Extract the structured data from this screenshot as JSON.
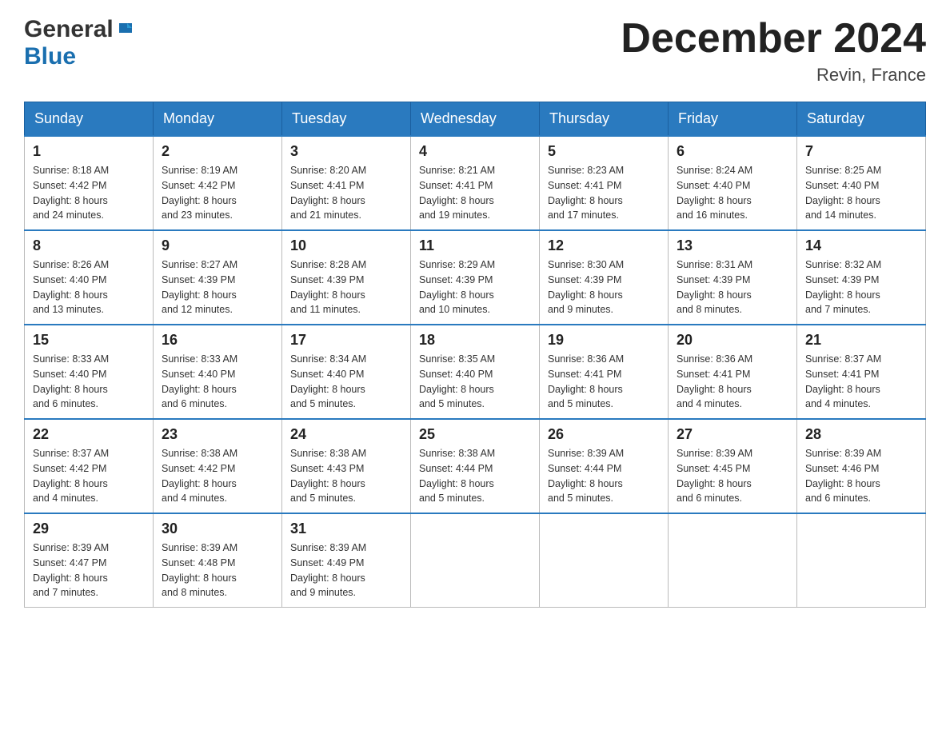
{
  "header": {
    "logo_general": "General",
    "logo_blue": "Blue",
    "month_title": "December 2024",
    "location": "Revin, France"
  },
  "weekdays": [
    "Sunday",
    "Monday",
    "Tuesday",
    "Wednesday",
    "Thursday",
    "Friday",
    "Saturday"
  ],
  "weeks": [
    [
      {
        "day": "1",
        "sunrise": "8:18 AM",
        "sunset": "4:42 PM",
        "daylight": "8 hours and 24 minutes."
      },
      {
        "day": "2",
        "sunrise": "8:19 AM",
        "sunset": "4:42 PM",
        "daylight": "8 hours and 23 minutes."
      },
      {
        "day": "3",
        "sunrise": "8:20 AM",
        "sunset": "4:41 PM",
        "daylight": "8 hours and 21 minutes."
      },
      {
        "day": "4",
        "sunrise": "8:21 AM",
        "sunset": "4:41 PM",
        "daylight": "8 hours and 19 minutes."
      },
      {
        "day": "5",
        "sunrise": "8:23 AM",
        "sunset": "4:41 PM",
        "daylight": "8 hours and 17 minutes."
      },
      {
        "day": "6",
        "sunrise": "8:24 AM",
        "sunset": "4:40 PM",
        "daylight": "8 hours and 16 minutes."
      },
      {
        "day": "7",
        "sunrise": "8:25 AM",
        "sunset": "4:40 PM",
        "daylight": "8 hours and 14 minutes."
      }
    ],
    [
      {
        "day": "8",
        "sunrise": "8:26 AM",
        "sunset": "4:40 PM",
        "daylight": "8 hours and 13 minutes."
      },
      {
        "day": "9",
        "sunrise": "8:27 AM",
        "sunset": "4:39 PM",
        "daylight": "8 hours and 12 minutes."
      },
      {
        "day": "10",
        "sunrise": "8:28 AM",
        "sunset": "4:39 PM",
        "daylight": "8 hours and 11 minutes."
      },
      {
        "day": "11",
        "sunrise": "8:29 AM",
        "sunset": "4:39 PM",
        "daylight": "8 hours and 10 minutes."
      },
      {
        "day": "12",
        "sunrise": "8:30 AM",
        "sunset": "4:39 PM",
        "daylight": "8 hours and 9 minutes."
      },
      {
        "day": "13",
        "sunrise": "8:31 AM",
        "sunset": "4:39 PM",
        "daylight": "8 hours and 8 minutes."
      },
      {
        "day": "14",
        "sunrise": "8:32 AM",
        "sunset": "4:39 PM",
        "daylight": "8 hours and 7 minutes."
      }
    ],
    [
      {
        "day": "15",
        "sunrise": "8:33 AM",
        "sunset": "4:40 PM",
        "daylight": "8 hours and 6 minutes."
      },
      {
        "day": "16",
        "sunrise": "8:33 AM",
        "sunset": "4:40 PM",
        "daylight": "8 hours and 6 minutes."
      },
      {
        "day": "17",
        "sunrise": "8:34 AM",
        "sunset": "4:40 PM",
        "daylight": "8 hours and 5 minutes."
      },
      {
        "day": "18",
        "sunrise": "8:35 AM",
        "sunset": "4:40 PM",
        "daylight": "8 hours and 5 minutes."
      },
      {
        "day": "19",
        "sunrise": "8:36 AM",
        "sunset": "4:41 PM",
        "daylight": "8 hours and 5 minutes."
      },
      {
        "day": "20",
        "sunrise": "8:36 AM",
        "sunset": "4:41 PM",
        "daylight": "8 hours and 4 minutes."
      },
      {
        "day": "21",
        "sunrise": "8:37 AM",
        "sunset": "4:41 PM",
        "daylight": "8 hours and 4 minutes."
      }
    ],
    [
      {
        "day": "22",
        "sunrise": "8:37 AM",
        "sunset": "4:42 PM",
        "daylight": "8 hours and 4 minutes."
      },
      {
        "day": "23",
        "sunrise": "8:38 AM",
        "sunset": "4:42 PM",
        "daylight": "8 hours and 4 minutes."
      },
      {
        "day": "24",
        "sunrise": "8:38 AM",
        "sunset": "4:43 PM",
        "daylight": "8 hours and 5 minutes."
      },
      {
        "day": "25",
        "sunrise": "8:38 AM",
        "sunset": "4:44 PM",
        "daylight": "8 hours and 5 minutes."
      },
      {
        "day": "26",
        "sunrise": "8:39 AM",
        "sunset": "4:44 PM",
        "daylight": "8 hours and 5 minutes."
      },
      {
        "day": "27",
        "sunrise": "8:39 AM",
        "sunset": "4:45 PM",
        "daylight": "8 hours and 6 minutes."
      },
      {
        "day": "28",
        "sunrise": "8:39 AM",
        "sunset": "4:46 PM",
        "daylight": "8 hours and 6 minutes."
      }
    ],
    [
      {
        "day": "29",
        "sunrise": "8:39 AM",
        "sunset": "4:47 PM",
        "daylight": "8 hours and 7 minutes."
      },
      {
        "day": "30",
        "sunrise": "8:39 AM",
        "sunset": "4:48 PM",
        "daylight": "8 hours and 8 minutes."
      },
      {
        "day": "31",
        "sunrise": "8:39 AM",
        "sunset": "4:49 PM",
        "daylight": "8 hours and 9 minutes."
      },
      null,
      null,
      null,
      null
    ]
  ],
  "labels": {
    "sunrise": "Sunrise:",
    "sunset": "Sunset:",
    "daylight": "Daylight:"
  }
}
